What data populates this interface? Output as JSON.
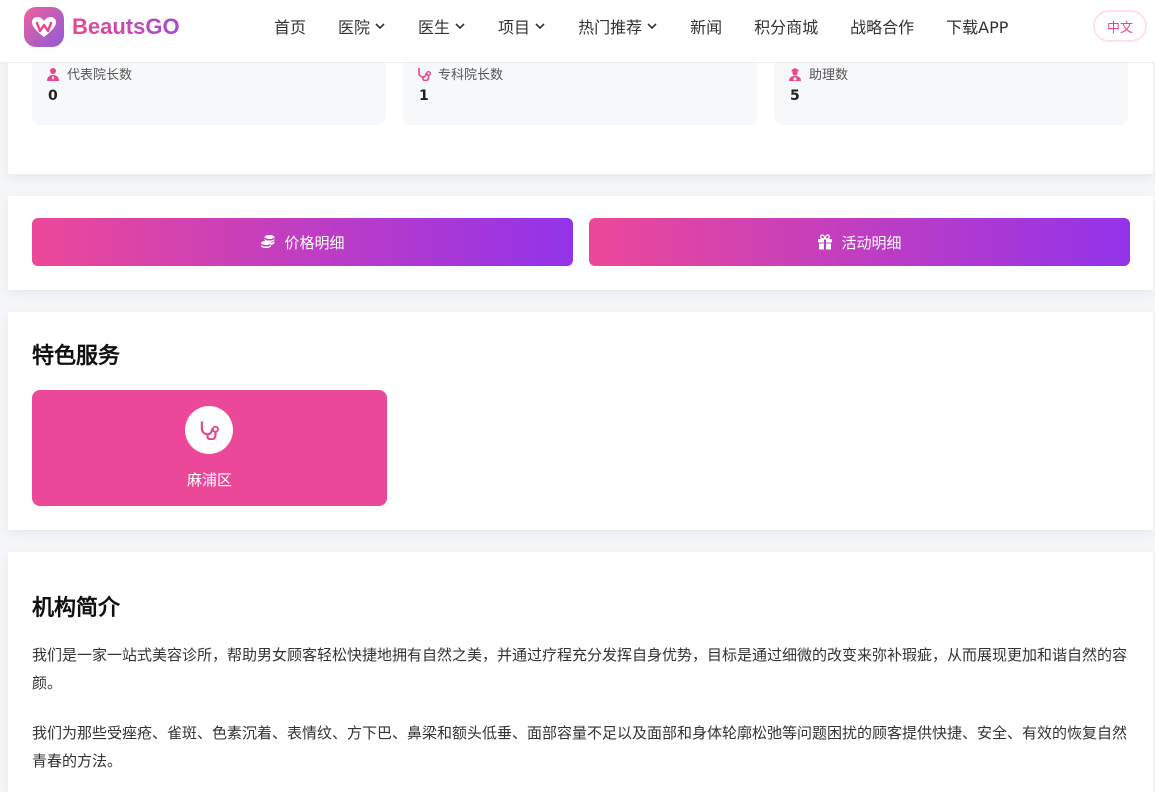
{
  "header": {
    "brand": "BeautsGO",
    "nav": [
      {
        "label": "首页",
        "dropdown": false
      },
      {
        "label": "医院",
        "dropdown": true
      },
      {
        "label": "医生",
        "dropdown": true
      },
      {
        "label": "项目",
        "dropdown": true
      },
      {
        "label": "热门推荐",
        "dropdown": true
      },
      {
        "label": "新闻",
        "dropdown": false
      },
      {
        "label": "积分商城",
        "dropdown": false
      },
      {
        "label": "战略合作",
        "dropdown": false
      },
      {
        "label": "下载APP",
        "dropdown": false
      }
    ],
    "language": "中文"
  },
  "stats": [
    {
      "label": "代表院长数",
      "value": "0",
      "icon": "user-tie-icon"
    },
    {
      "label": "专科院长数",
      "value": "1",
      "icon": "stethoscope-icon"
    },
    {
      "label": "助理数",
      "value": "5",
      "icon": "user-nurse-icon"
    }
  ],
  "buttons": {
    "price_details": "价格明细",
    "activity_details": "活动明细"
  },
  "services": {
    "title": "特色服务",
    "items": [
      {
        "label": "麻浦区",
        "icon": "stethoscope-icon"
      }
    ]
  },
  "intro": {
    "title": "机构简介",
    "paragraphs": [
      "我们是一家一站式美容诊所，帮助男女顾客轻松快捷地拥有自然之美，并通过疗程充分发挥自身优势，目标是通过细微的改变来弥补瑕疵，从而展现更加和谐自然的容颜。",
      "我们为那些受痤疮、雀斑、色素沉着、表情纹、方下巴、鼻梁和额头低垂、面部容量不足以及面部和身体轮廓松弛等问题困扰的顾客提供快捷、安全、有效的恢复自然青春的方法。"
    ]
  },
  "colors": {
    "accent_pink": "#ec4899",
    "accent_purple": "#9333ea"
  }
}
